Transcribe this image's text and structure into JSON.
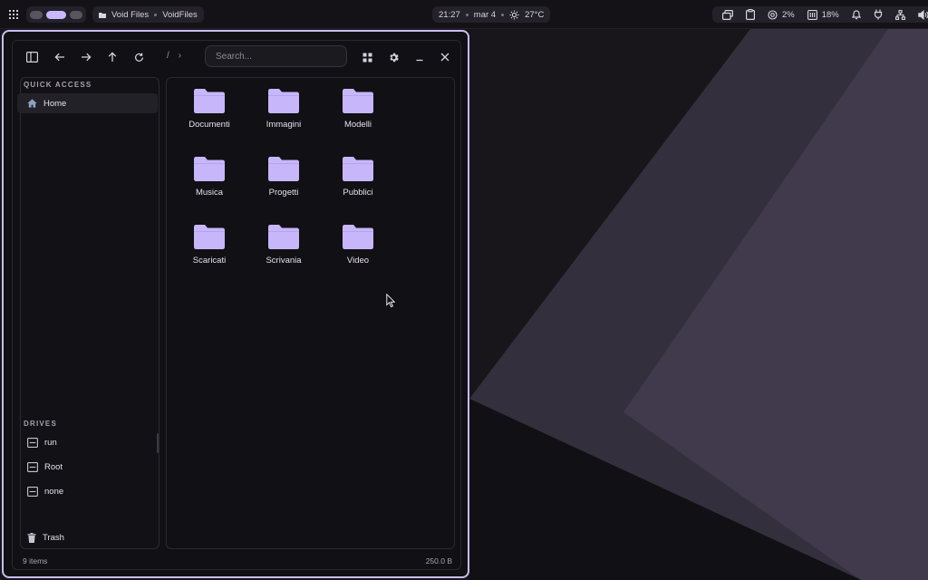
{
  "topbar": {
    "app_name": "Void Files",
    "window_title": "VoidFiles",
    "time": "21:27",
    "date": "mar 4",
    "weather": "27°C",
    "cpu": "2%",
    "memory": "18%"
  },
  "toolbar": {
    "crumb_root": "/",
    "crumb_sep": "›",
    "search_placeholder": "Search..."
  },
  "sidebar": {
    "quick_access_heading": "QUICK ACCESS",
    "quick_access": [
      {
        "label": "Home",
        "icon": "home-icon"
      }
    ],
    "drives_heading": "DRIVES",
    "drives": [
      {
        "label": "run",
        "icon": "drive-icon"
      },
      {
        "label": "Root",
        "icon": "drive-icon"
      },
      {
        "label": "none",
        "icon": "drive-icon"
      }
    ],
    "trash": {
      "label": "Trash",
      "icon": "trash-icon"
    }
  },
  "folders": [
    "Documenti",
    "Immagini",
    "Modelli",
    "Musica",
    "Progetti",
    "Pubblici",
    "Scaricati",
    "Scrivania",
    "Video"
  ],
  "statusbar": {
    "item_count": "9 items",
    "total_size": "250.0 B"
  },
  "colors": {
    "accent": "#c9b8ff",
    "folder": "#c8b6fb",
    "window_border": "#cbbcf2",
    "wallpaper_shape": "#403a4c"
  }
}
